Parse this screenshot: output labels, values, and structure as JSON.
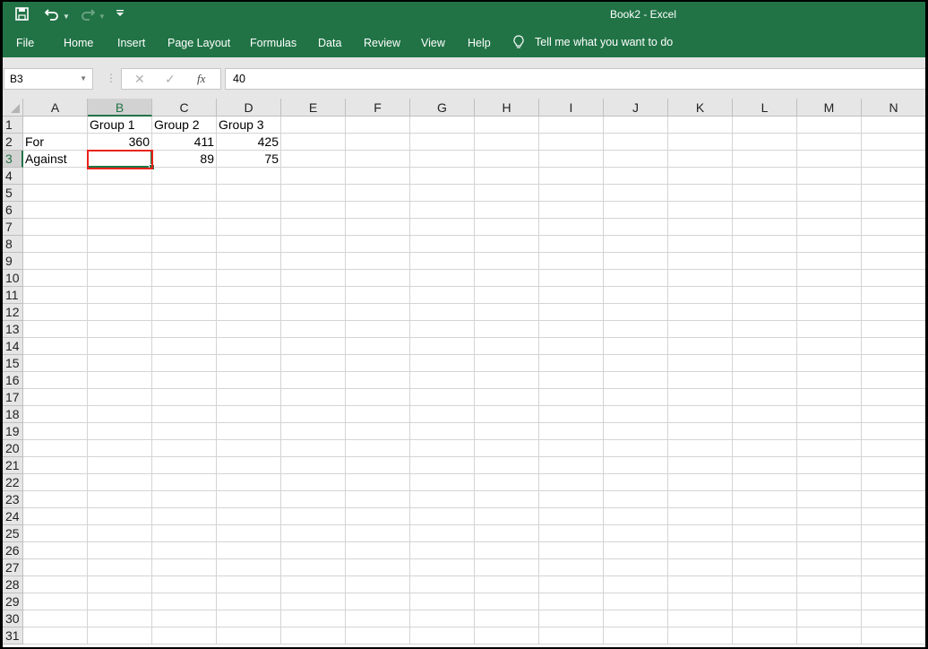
{
  "window": {
    "title": "Book2  -  Excel",
    "accent_color": "#217346",
    "quick_access": [
      {
        "icon": "save-icon"
      },
      {
        "icon": "undo-icon"
      },
      {
        "icon": "redo-icon"
      },
      {
        "icon": "customize-qat-icon"
      }
    ]
  },
  "ribbon": {
    "tabs": [
      "File",
      "Home",
      "Insert",
      "Page Layout",
      "Formulas",
      "Data",
      "Review",
      "View",
      "Help"
    ],
    "tell_me": "Tell me what you want to do"
  },
  "formula_bar": {
    "name_box": "B3",
    "cancel_icon": "✕",
    "enter_icon": "✓",
    "fx_label": "fx",
    "value": "40"
  },
  "sheet": {
    "columns": [
      "A",
      "B",
      "C",
      "D",
      "E",
      "F",
      "G",
      "H",
      "I",
      "J",
      "K",
      "L",
      "M",
      "N"
    ],
    "rows": [
      "1",
      "2",
      "3",
      "4",
      "5",
      "6",
      "7",
      "8",
      "9",
      "10",
      "11",
      "12",
      "13",
      "14",
      "15",
      "16",
      "17",
      "18",
      "19",
      "20",
      "21",
      "22",
      "23",
      "24",
      "25",
      "26",
      "27",
      "28",
      "29",
      "30",
      "31"
    ],
    "selected_cell": "B3",
    "cells": [
      {
        "ref": "B1",
        "value": "Group 1",
        "type": "text"
      },
      {
        "ref": "C1",
        "value": "Group 2",
        "type": "text"
      },
      {
        "ref": "D1",
        "value": "Group 3",
        "type": "text"
      },
      {
        "ref": "A2",
        "value": "For",
        "type": "text"
      },
      {
        "ref": "B2",
        "value": "360",
        "type": "num"
      },
      {
        "ref": "C2",
        "value": "411",
        "type": "num"
      },
      {
        "ref": "D2",
        "value": "425",
        "type": "num"
      },
      {
        "ref": "A3",
        "value": "Against",
        "type": "text"
      },
      {
        "ref": "B3",
        "value": "",
        "type": "num"
      },
      {
        "ref": "C3",
        "value": "89",
        "type": "num"
      },
      {
        "ref": "D3",
        "value": "75",
        "type": "num"
      }
    ],
    "annotation": {
      "ref": "B3",
      "color": "#e8231b"
    }
  }
}
